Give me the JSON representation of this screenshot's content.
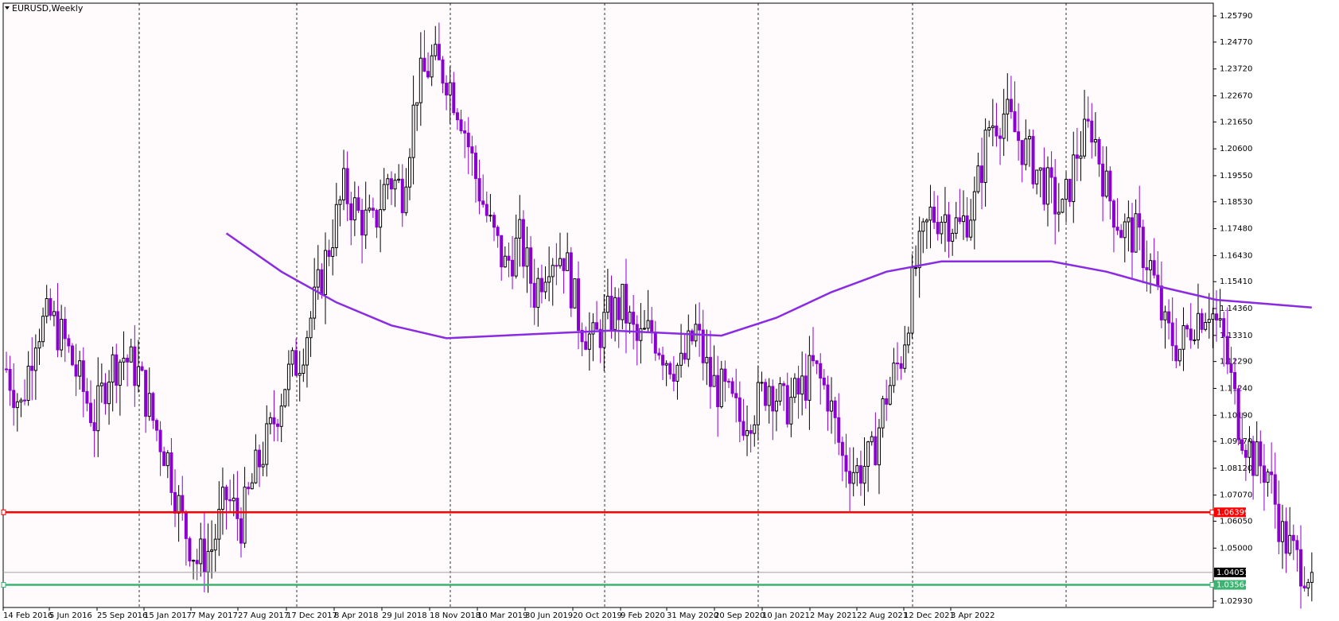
{
  "symbol_label": "EURUSD,Weekly",
  "colors": {
    "background": "#fffbfd",
    "candle": "#000000",
    "candle_down": "#8b00d1",
    "ma": "#8a2be2",
    "support_line": "#ff0000",
    "low_line": "#3cb371",
    "current_line": "#a0a0a0",
    "grid_vertical": "#000000"
  },
  "chart_data": {
    "type": "candlestick",
    "title": "EURUSD,Weekly",
    "timeframe": "Weekly",
    "ylim": [
      1.0268,
      1.2629
    ],
    "y_ticks": [
      "1.25790",
      "1.24770",
      "1.23720",
      "1.22670",
      "1.21650",
      "1.20600",
      "1.19550",
      "1.18530",
      "1.17480",
      "1.16430",
      "1.15410",
      "1.14360",
      "1.13310",
      "1.12290",
      "1.11240",
      "1.10190",
      "1.09170",
      "1.08120",
      "1.07070",
      "1.06050",
      "1.05000",
      "1.02930"
    ],
    "x_ticks": [
      "14 Feb 2016",
      "5 Jun 2016",
      "25 Sep 2016",
      "15 Jan 2017",
      "7 May 2017",
      "27 Aug 2017",
      "17 Dec 2017",
      "8 Apr 2018",
      "29 Jul 2018",
      "18 Nov 2018",
      "10 Mar 2019",
      "30 Jun 2019",
      "20 Oct 2019",
      "9 Feb 2020",
      "31 May 2020",
      "20 Sep 2020",
      "10 Jan 2021",
      "2 May 2021",
      "22 Aug 2021",
      "12 Dec 2021",
      "3 Apr 2022"
    ],
    "week_count": 330,
    "horizontal_lines": [
      {
        "name": "support",
        "price": 1.06399,
        "label": "1.06399"
      },
      {
        "name": "current",
        "price": 1.04051,
        "label": "1.04051"
      },
      {
        "name": "low",
        "price": 1.03564,
        "label": "1.03564"
      }
    ],
    "price_path": [
      [
        0,
        1.12
      ],
      [
        4,
        1.105
      ],
      [
        8,
        1.135
      ],
      [
        12,
        1.14
      ],
      [
        16,
        1.13
      ],
      [
        20,
        1.115
      ],
      [
        24,
        1.1
      ],
      [
        28,
        1.12
      ],
      [
        32,
        1.125
      ],
      [
        36,
        1.118
      ],
      [
        40,
        1.1
      ],
      [
        44,
        1.085
      ],
      [
        48,
        1.06
      ],
      [
        52,
        1.045
      ],
      [
        56,
        1.05
      ],
      [
        60,
        1.07
      ],
      [
        64,
        1.06
      ],
      [
        68,
        1.08
      ],
      [
        72,
        1.095
      ],
      [
        76,
        1.115
      ],
      [
        80,
        1.125
      ],
      [
        84,
        1.145
      ],
      [
        88,
        1.168
      ],
      [
        92,
        1.19
      ],
      [
        96,
        1.18
      ],
      [
        100,
        1.175
      ],
      [
        104,
        1.195
      ],
      [
        108,
        1.19
      ],
      [
        112,
        1.23
      ],
      [
        116,
        1.24
      ],
      [
        120,
        1.235
      ],
      [
        124,
        1.22
      ],
      [
        128,
        1.195
      ],
      [
        132,
        1.175
      ],
      [
        136,
        1.16
      ],
      [
        140,
        1.17
      ],
      [
        144,
        1.15
      ],
      [
        148,
        1.165
      ],
      [
        152,
        1.165
      ],
      [
        156,
        1.14
      ],
      [
        160,
        1.13
      ],
      [
        164,
        1.14
      ],
      [
        168,
        1.145
      ],
      [
        172,
        1.13
      ],
      [
        176,
        1.135
      ],
      [
        180,
        1.125
      ],
      [
        184,
        1.12
      ],
      [
        188,
        1.135
      ],
      [
        192,
        1.115
      ],
      [
        196,
        1.11
      ],
      [
        200,
        1.1
      ],
      [
        204,
        1.105
      ],
      [
        208,
        1.115
      ],
      [
        212,
        1.105
      ],
      [
        216,
        1.11
      ],
      [
        220,
        1.12
      ],
      [
        224,
        1.11
      ],
      [
        228,
        1.085
      ],
      [
        232,
        1.08
      ],
      [
        236,
        1.085
      ],
      [
        240,
        1.11
      ],
      [
        244,
        1.125
      ],
      [
        248,
        1.16
      ],
      [
        252,
        1.18
      ],
      [
        256,
        1.18
      ],
      [
        260,
        1.175
      ],
      [
        264,
        1.185
      ],
      [
        268,
        1.215
      ],
      [
        272,
        1.22
      ],
      [
        276,
        1.21
      ],
      [
        280,
        1.2
      ],
      [
        284,
        1.19
      ],
      [
        288,
        1.18
      ],
      [
        292,
        1.205
      ],
      [
        296,
        1.215
      ],
      [
        300,
        1.19
      ],
      [
        304,
        1.175
      ],
      [
        308,
        1.172
      ],
      [
        312,
        1.16
      ],
      [
        316,
        1.135
      ],
      [
        320,
        1.128
      ],
      [
        324,
        1.14
      ],
      [
        328,
        1.145
      ],
      [
        332,
        1.13
      ],
      [
        336,
        1.1
      ],
      [
        340,
        1.085
      ],
      [
        344,
        1.08
      ],
      [
        348,
        1.055
      ],
      [
        352,
        1.045
      ],
      [
        356,
        1.0405
      ]
    ],
    "moving_average": [
      [
        60,
        1.173
      ],
      [
        75,
        1.158
      ],
      [
        90,
        1.146
      ],
      [
        105,
        1.137
      ],
      [
        120,
        1.132
      ],
      [
        135,
        1.133
      ],
      [
        150,
        1.134
      ],
      [
        165,
        1.135
      ],
      [
        180,
        1.134
      ],
      [
        195,
        1.133
      ],
      [
        210,
        1.14
      ],
      [
        225,
        1.15
      ],
      [
        240,
        1.158
      ],
      [
        255,
        1.162
      ],
      [
        270,
        1.162
      ],
      [
        285,
        1.162
      ],
      [
        300,
        1.158
      ],
      [
        315,
        1.152
      ],
      [
        330,
        1.147
      ],
      [
        356,
        1.144
      ]
    ]
  }
}
